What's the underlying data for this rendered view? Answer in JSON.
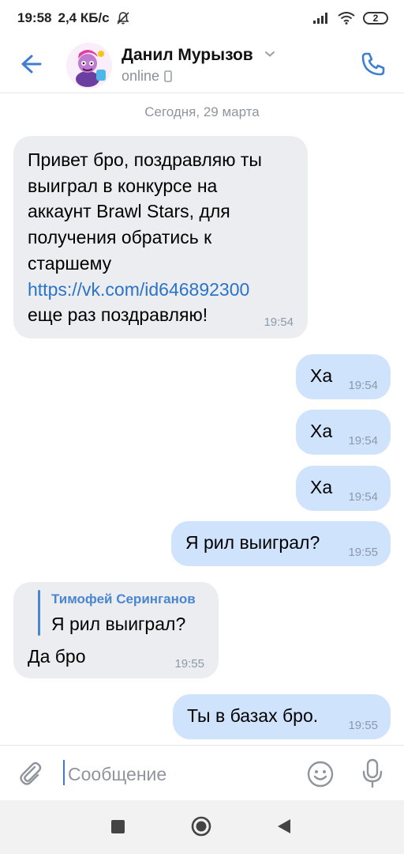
{
  "status_bar": {
    "time": "19:58",
    "speed": "2,4 КБ/с",
    "battery": "2",
    "icons": [
      "muted-bell-icon",
      "signal-icon",
      "wifi-icon",
      "battery-icon"
    ]
  },
  "header": {
    "contact_name": "Данил Мурызов",
    "status": "online",
    "icons": [
      "back-arrow-icon",
      "chevron-down-icon",
      "mobile-icon",
      "phone-icon"
    ],
    "accent_color": "#3f7fd0"
  },
  "chat": {
    "date_separator": "Сегодня, 29 марта",
    "messages": [
      {
        "direction": "incoming",
        "lines": [
          "Привет бро, поздравляю ты",
          "выиграл в конкурсе на",
          "аккаунт Brawl Stars, для",
          "получения обратись к",
          "старшему"
        ],
        "link": "https://vk.com/id646892300",
        "after_link": "еще раз поздравляю!",
        "time": "19:54"
      },
      {
        "direction": "outgoing",
        "text": "Ха",
        "time": "19:54"
      },
      {
        "direction": "outgoing",
        "text": "Ха",
        "time": "19:54"
      },
      {
        "direction": "outgoing",
        "text": "Ха",
        "time": "19:54"
      },
      {
        "direction": "outgoing",
        "text": "Я рил выиграл?",
        "time": "19:55"
      },
      {
        "direction": "incoming",
        "reply_author": "Тимофей Серинганов",
        "reply_text": "Я рил выиграл?",
        "text": "Да бро",
        "time": "19:55"
      },
      {
        "direction": "outgoing",
        "text": "Ты в базах бро.",
        "time": "19:55"
      }
    ],
    "colors": {
      "incoming_bubble": "#ebedf1",
      "outgoing_bubble": "#cfe3fd",
      "link": "#2a73c7"
    }
  },
  "input_bar": {
    "placeholder": "Сообщение",
    "icons": [
      "paperclip-icon",
      "emoji-icon",
      "microphone-icon"
    ]
  },
  "nav_bar": {
    "icons": [
      "recents-icon",
      "home-icon",
      "back-icon"
    ]
  }
}
